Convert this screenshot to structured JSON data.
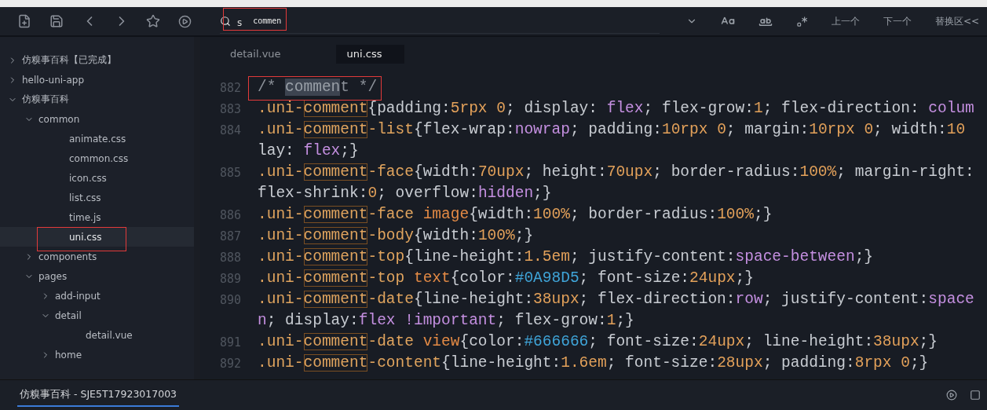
{
  "find_bar": {
    "prefix": "s",
    "value": "commen",
    "prev": "上一个",
    "next": "下一个",
    "replace": "替换区<<"
  },
  "sidebar": {
    "items": [
      {
        "label": "仿糗事百科【已完成】",
        "kind": "folder",
        "expanded": false,
        "selected": false
      },
      {
        "label": "hello-uni-app",
        "kind": "folder",
        "expanded": false,
        "selected": false
      },
      {
        "label": "仿糗事百科",
        "kind": "folder",
        "expanded": true,
        "selected": false,
        "children": [
          {
            "label": "common",
            "kind": "folder",
            "expanded": true,
            "selected": false,
            "children": [
              {
                "label": "animate.css",
                "kind": "file",
                "selected": false
              },
              {
                "label": "common.css",
                "kind": "file",
                "selected": false
              },
              {
                "label": "icon.css",
                "kind": "file",
                "selected": false
              },
              {
                "label": "list.css",
                "kind": "file",
                "selected": false
              },
              {
                "label": "time.js",
                "kind": "file",
                "selected": false
              },
              {
                "label": "uni.css",
                "kind": "file",
                "selected": true
              }
            ]
          },
          {
            "label": "components",
            "kind": "folder",
            "expanded": false,
            "selected": false
          },
          {
            "label": "pages",
            "kind": "folder",
            "expanded": true,
            "selected": false,
            "children": [
              {
                "label": "add-input",
                "kind": "folder",
                "expanded": false,
                "selected": false
              },
              {
                "label": "detail",
                "kind": "folder",
                "expanded": true,
                "selected": false,
                "children": [
                  {
                    "label": "detail.vue",
                    "kind": "file",
                    "selected": false
                  }
                ]
              },
              {
                "label": "home",
                "kind": "folder",
                "expanded": false,
                "selected": false
              }
            ]
          }
        ]
      }
    ]
  },
  "tabs": [
    {
      "label": "detail.vue",
      "selected": false
    },
    {
      "label": "uni.css",
      "selected": true
    }
  ],
  "code": [
    {
      "number": "882",
      "tokens": [
        {
          "kind": "comment",
          "text": "/* "
        },
        {
          "kind": "commentmatch",
          "text": "commen"
        },
        {
          "kind": "comment",
          "text": "t */"
        }
      ]
    },
    {
      "number": "883",
      "tokens": [
        {
          "kind": "selector",
          "text": ".uni-"
        },
        {
          "kind": "match",
          "text": "comment"
        },
        {
          "kind": "plain",
          "text": "{padding:"
        },
        {
          "kind": "number",
          "text": "5rpx 0"
        },
        {
          "kind": "plain",
          "text": "; display: "
        },
        {
          "kind": "keyword",
          "text": "flex"
        },
        {
          "kind": "plain",
          "text": "; flex-grow:"
        },
        {
          "kind": "number",
          "text": "1"
        },
        {
          "kind": "plain",
          "text": "; flex-direction: "
        },
        {
          "kind": "keyword",
          "text": "colum"
        }
      ]
    },
    {
      "number": "884",
      "tokens": [
        {
          "kind": "selector",
          "text": ".uni-"
        },
        {
          "kind": "match",
          "text": "comment"
        },
        {
          "kind": "selector",
          "text": "-list"
        },
        {
          "kind": "plain",
          "text": "{flex-wrap:"
        },
        {
          "kind": "keyword",
          "text": "nowrap"
        },
        {
          "kind": "plain",
          "text": "; padding:"
        },
        {
          "kind": "number",
          "text": "10rpx 0"
        },
        {
          "kind": "plain",
          "text": "; margin:"
        },
        {
          "kind": "number",
          "text": "10rpx 0"
        },
        {
          "kind": "plain",
          "text": "; width:"
        },
        {
          "kind": "number",
          "text": "10"
        }
      ]
    },
    {
      "tokens": [
        {
          "kind": "plain",
          "text": "lay: "
        },
        {
          "kind": "keyword",
          "text": "flex"
        },
        {
          "kind": "plain",
          "text": ";}"
        }
      ]
    },
    {
      "number": "885",
      "tokens": [
        {
          "kind": "selector",
          "text": ".uni-"
        },
        {
          "kind": "match",
          "text": "comment"
        },
        {
          "kind": "selector",
          "text": "-face"
        },
        {
          "kind": "plain",
          "text": "{width:"
        },
        {
          "kind": "number",
          "text": "70upx"
        },
        {
          "kind": "plain",
          "text": "; height:"
        },
        {
          "kind": "number",
          "text": "70upx"
        },
        {
          "kind": "plain",
          "text": "; border-radius:"
        },
        {
          "kind": "number",
          "text": "100%"
        },
        {
          "kind": "plain",
          "text": "; margin-right:"
        }
      ]
    },
    {
      "tokens": [
        {
          "kind": "plain",
          "text": "flex-shrink:"
        },
        {
          "kind": "number",
          "text": "0"
        },
        {
          "kind": "plain",
          "text": "; overflow:"
        },
        {
          "kind": "keyword",
          "text": "hidden"
        },
        {
          "kind": "plain",
          "text": ";}"
        }
      ]
    },
    {
      "number": "886",
      "tokens": [
        {
          "kind": "selector",
          "text": ".uni-"
        },
        {
          "kind": "match",
          "text": "comment"
        },
        {
          "kind": "selector",
          "text": "-face "
        },
        {
          "kind": "tag",
          "text": "image"
        },
        {
          "kind": "plain",
          "text": "{width:"
        },
        {
          "kind": "number",
          "text": "100%"
        },
        {
          "kind": "plain",
          "text": "; border-radius:"
        },
        {
          "kind": "number",
          "text": "100%"
        },
        {
          "kind": "plain",
          "text": ";}"
        }
      ]
    },
    {
      "number": "887",
      "tokens": [
        {
          "kind": "selector",
          "text": ".uni-"
        },
        {
          "kind": "match",
          "text": "comment"
        },
        {
          "kind": "selector",
          "text": "-body"
        },
        {
          "kind": "plain",
          "text": "{width:"
        },
        {
          "kind": "number",
          "text": "100%"
        },
        {
          "kind": "plain",
          "text": ";}"
        }
      ]
    },
    {
      "number": "888",
      "tokens": [
        {
          "kind": "selector",
          "text": ".uni-"
        },
        {
          "kind": "match",
          "text": "comment"
        },
        {
          "kind": "selector",
          "text": "-top"
        },
        {
          "kind": "plain",
          "text": "{line-height:"
        },
        {
          "kind": "number",
          "text": "1.5em"
        },
        {
          "kind": "plain",
          "text": "; justify-content:"
        },
        {
          "kind": "keyword",
          "text": "space-between"
        },
        {
          "kind": "plain",
          "text": ";}"
        }
      ]
    },
    {
      "number": "889",
      "tokens": [
        {
          "kind": "selector",
          "text": ".uni-"
        },
        {
          "kind": "match",
          "text": "comment"
        },
        {
          "kind": "selector",
          "text": "-top "
        },
        {
          "kind": "tag",
          "text": "text"
        },
        {
          "kind": "plain",
          "text": "{color:"
        },
        {
          "kind": "hex",
          "text": "#0A98D5"
        },
        {
          "kind": "plain",
          "text": "; font-size:"
        },
        {
          "kind": "number",
          "text": "24upx"
        },
        {
          "kind": "plain",
          "text": ";}"
        }
      ]
    },
    {
      "number": "890",
      "tokens": [
        {
          "kind": "selector",
          "text": ".uni-"
        },
        {
          "kind": "match",
          "text": "comment"
        },
        {
          "kind": "selector",
          "text": "-date"
        },
        {
          "kind": "plain",
          "text": "{line-height:"
        },
        {
          "kind": "number",
          "text": "38upx"
        },
        {
          "kind": "plain",
          "text": "; flex-direction:"
        },
        {
          "kind": "keyword",
          "text": "row"
        },
        {
          "kind": "plain",
          "text": "; justify-content:"
        },
        {
          "kind": "keyword",
          "text": "space"
        }
      ]
    },
    {
      "tokens": [
        {
          "kind": "keyword",
          "text": "n"
        },
        {
          "kind": "plain",
          "text": "; display:"
        },
        {
          "kind": "keyword",
          "text": "flex !important"
        },
        {
          "kind": "plain",
          "text": "; flex-grow:"
        },
        {
          "kind": "number",
          "text": "1"
        },
        {
          "kind": "plain",
          "text": ";}"
        }
      ]
    },
    {
      "number": "891",
      "tokens": [
        {
          "kind": "selector",
          "text": ".uni-"
        },
        {
          "kind": "match",
          "text": "comment"
        },
        {
          "kind": "selector",
          "text": "-date "
        },
        {
          "kind": "tag",
          "text": "view"
        },
        {
          "kind": "plain",
          "text": "{color:"
        },
        {
          "kind": "hex",
          "text": "#666666"
        },
        {
          "kind": "plain",
          "text": "; font-size:"
        },
        {
          "kind": "number",
          "text": "24upx"
        },
        {
          "kind": "plain",
          "text": "; line-height:"
        },
        {
          "kind": "number",
          "text": "38upx"
        },
        {
          "kind": "plain",
          "text": ";}"
        }
      ]
    },
    {
      "number": "892",
      "tokens": [
        {
          "kind": "selector",
          "text": ".uni-"
        },
        {
          "kind": "match",
          "text": "comment"
        },
        {
          "kind": "selector",
          "text": "-content"
        },
        {
          "kind": "plain",
          "text": "{line-height:"
        },
        {
          "kind": "number",
          "text": "1.6em"
        },
        {
          "kind": "plain",
          "text": "; font-size:"
        },
        {
          "kind": "number",
          "text": "28upx"
        },
        {
          "kind": "plain",
          "text": "; padding:"
        },
        {
          "kind": "number",
          "text": "8rpx 0"
        },
        {
          "kind": "plain",
          "text": ";}"
        }
      ]
    }
  ],
  "status_bar": {
    "project": "仿糗事百科 - SJE5T17923017003"
  }
}
